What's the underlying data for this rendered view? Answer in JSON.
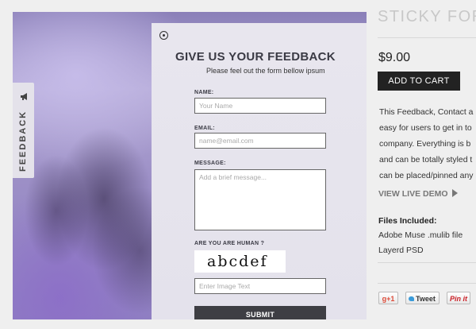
{
  "feedback_tab": {
    "label": "FEEDBACK",
    "icon": "megaphone-icon"
  },
  "form": {
    "title": "GIVE US YOUR FEEDBACK",
    "subtitle": "Please feel out the form bellow ipsum",
    "name_label": "NAME:",
    "name_placeholder": "Your Name",
    "email_label": "EMAIL:",
    "email_placeholder": "name@email.com",
    "message_label": "MESSAGE:",
    "message_placeholder": "Add a brief message...",
    "human_label": "ARE YOU ARE HUMAN ?",
    "captcha_text": "abcdef",
    "captcha_placeholder": "Enter Image Text",
    "submit_label": "SUBMIT"
  },
  "product": {
    "title": "STICKY FORM",
    "price": "$9.00",
    "add_to_cart": "ADD TO CART",
    "description_lines": [
      "This Feedback, Contact a",
      "easy for users to get in to",
      "company. Everything is b",
      "and can be totally styled t",
      "can be placed/pinned any"
    ],
    "live_demo": "VIEW LIVE DEMO",
    "files_heading": "Files Included:",
    "files": [
      "Adobe Muse .mulib file",
      "Layerd PSD"
    ]
  },
  "share": {
    "gplus": "+1",
    "tweet": "Tweet",
    "pinit": "Pin it"
  },
  "colors": {
    "accent_dark": "#222222",
    "panel_bg": "#e6e4ec"
  }
}
